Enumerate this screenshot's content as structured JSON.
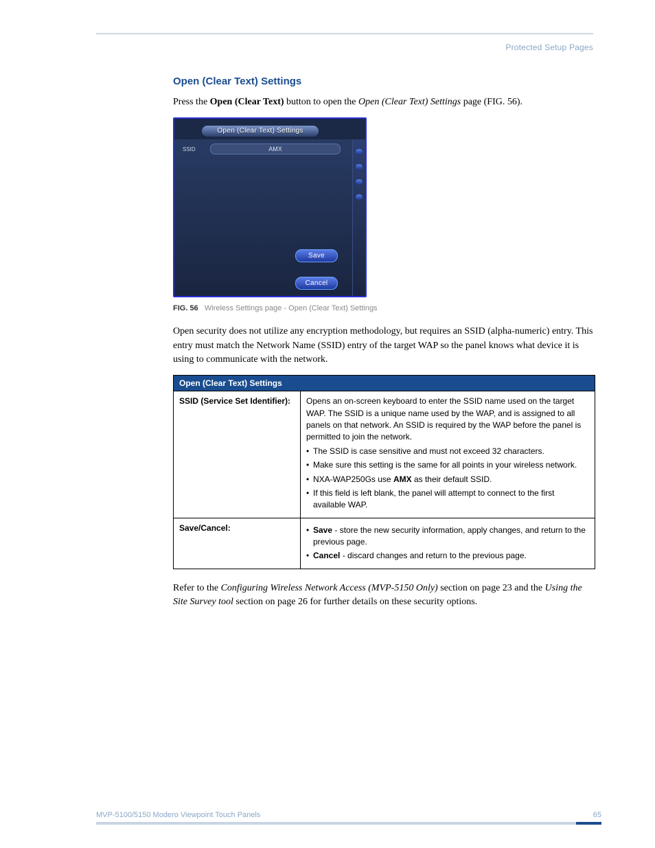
{
  "running_head": "Protected Setup Pages",
  "section_title": "Open (Clear Text) Settings",
  "intro": {
    "pre": "Press the ",
    "btn": "Open (Clear Text)",
    "mid": " button to open the ",
    "page": "Open (Clear Text) Settings",
    "post": " page (FIG. 56)."
  },
  "device": {
    "tab": "Open (Clear Text) Settings",
    "ssid_label": "SSID",
    "ssid_value": "AMX",
    "save": "Save",
    "cancel": "Cancel"
  },
  "caption": {
    "fig": "FIG. 56",
    "text": "Wireless Settings page - Open (Clear Text) Settings"
  },
  "para": "Open security does not utilize any encryption methodology, but requires an SSID (alpha-numeric) entry. This entry must match the Network Name (SSID) entry of the target WAP so the panel knows what device it is using to communicate with the network.",
  "table": {
    "title": "Open (Clear Text) Settings",
    "row1": {
      "label": "SSID (Service Set Identifier):",
      "desc": "Opens an on-screen keyboard to enter the SSID name used on the target WAP. The SSID is a unique name used by the WAP, and is assigned to all panels on that network. An SSID is required by the WAP before the panel is permitted to join the network.",
      "bullets": [
        "The SSID is case sensitive and must not exceed 32 characters.",
        "Make sure this setting is the same for all points in your wireless network.",
        [
          "NXA-WAP250Gs use ",
          "AMX",
          " as their default SSID."
        ],
        "If this field is left blank, the panel will attempt to connect to the first available WAP."
      ]
    },
    "row2": {
      "label": "Save/Cancel:",
      "bullets": [
        [
          "Save",
          " - store the new security information, apply changes, and return to the previous page."
        ],
        [
          "Cancel",
          " - discard changes and return to the previous page."
        ]
      ]
    }
  },
  "outro": {
    "pre": "Refer to the ",
    "i1": "Configuring Wireless Network Access (MVP-5150 Only)",
    "mid1": " section on page 23 and the ",
    "i2": "Using the Site Survey tool",
    "mid2": " section on page 26 for further details on these security options."
  },
  "footer": {
    "left": "MVP-5100/5150 Modero Viewpoint  Touch Panels",
    "right": "65"
  }
}
